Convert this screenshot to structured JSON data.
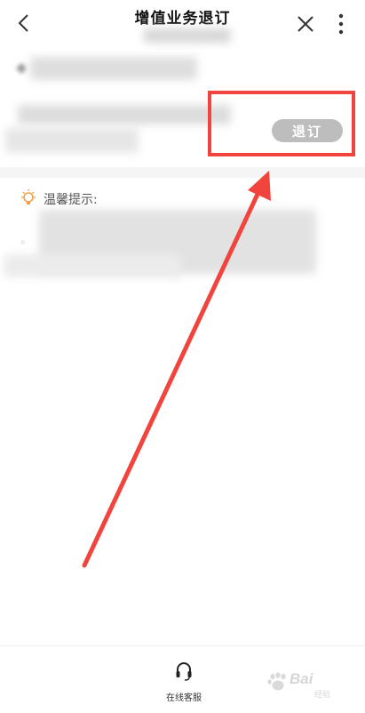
{
  "header": {
    "title": "增值业务退订",
    "back_icon": "back-arrow-icon",
    "close_icon": "close-icon",
    "more_icon": "more-vertical-icon"
  },
  "service": {
    "unsubscribe_label": "退订"
  },
  "tips": {
    "label": "温馨提示:",
    "bullet": "◦",
    "icon": "lightbulb-icon"
  },
  "footer": {
    "online_service_label": "在线客服",
    "icon": "headset-icon"
  },
  "watermark": {
    "brand": "Bai",
    "sub": "经验"
  },
  "colors": {
    "annotation_red": "#f0443c",
    "button_gray": "#bdbdbd",
    "accent_orange": "#f0a04b"
  }
}
